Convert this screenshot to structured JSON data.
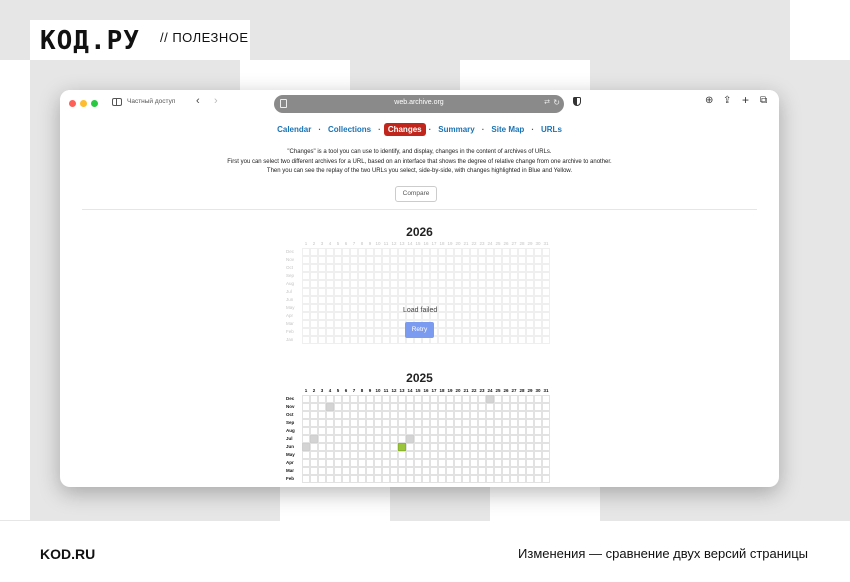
{
  "brand": {
    "logo": "КОД.РУ",
    "section": "// ПОЛЕЗНОЕ"
  },
  "footer": {
    "site": "KOD.RU",
    "caption": "Изменения — сравнение двух версий страницы"
  },
  "browser": {
    "private_label": "Частный доступ",
    "url": "web.archive.org",
    "icons": [
      "sidebar-icon",
      "back-icon",
      "forward-icon",
      "page-icon",
      "translate-icon",
      "reload-icon",
      "shield-icon",
      "download-icon",
      "share-icon",
      "new-tab-icon",
      "tabs-icon"
    ]
  },
  "nav": {
    "items": [
      "Calendar",
      "Collections",
      "Changes",
      "Summary",
      "Site Map",
      "URLs"
    ],
    "active": "Changes",
    "separator": "·"
  },
  "description": {
    "line1": "\"Changes\" is a tool you can use to identify, and display, changes in the content of archives of URLs.",
    "line2": "First you can select two different archives for a URL, based on an interface that shows the degree of relative change from one archive to another.",
    "line3": "Then you can see the replay of the two URLs you select, side-by-side, with changes highlighted in Blue and Yellow."
  },
  "compare_label": "Compare",
  "calendar": {
    "days": [
      "1",
      "2",
      "3",
      "4",
      "5",
      "6",
      "7",
      "8",
      "9",
      "10",
      "11",
      "12",
      "13",
      "14",
      "15",
      "16",
      "17",
      "18",
      "19",
      "20",
      "21",
      "22",
      "23",
      "24",
      "25",
      "26",
      "27",
      "28",
      "29",
      "30",
      "31"
    ],
    "months_2026": [
      "Dec",
      "Nov",
      "Oct",
      "Sep",
      "Aug",
      "Jul",
      "Jun",
      "May",
      "Apr",
      "Mar",
      "Feb",
      "Jan"
    ],
    "months_2025": [
      "Dec",
      "Nov",
      "Oct",
      "Sep",
      "Aug",
      "Jul",
      "Jun",
      "May",
      "Apr",
      "Mar",
      "Feb"
    ],
    "year_2026": "2026",
    "year_2025": "2025",
    "load_failed": "Load failed",
    "retry_label": "Retry",
    "highlight_colors": {
      "grey": "#d4d4d4",
      "green": "#9bc53d"
    }
  },
  "colors": {
    "active_tab": "#c0261b",
    "link": "#1a73b5",
    "retry": "#7b9bf0"
  }
}
